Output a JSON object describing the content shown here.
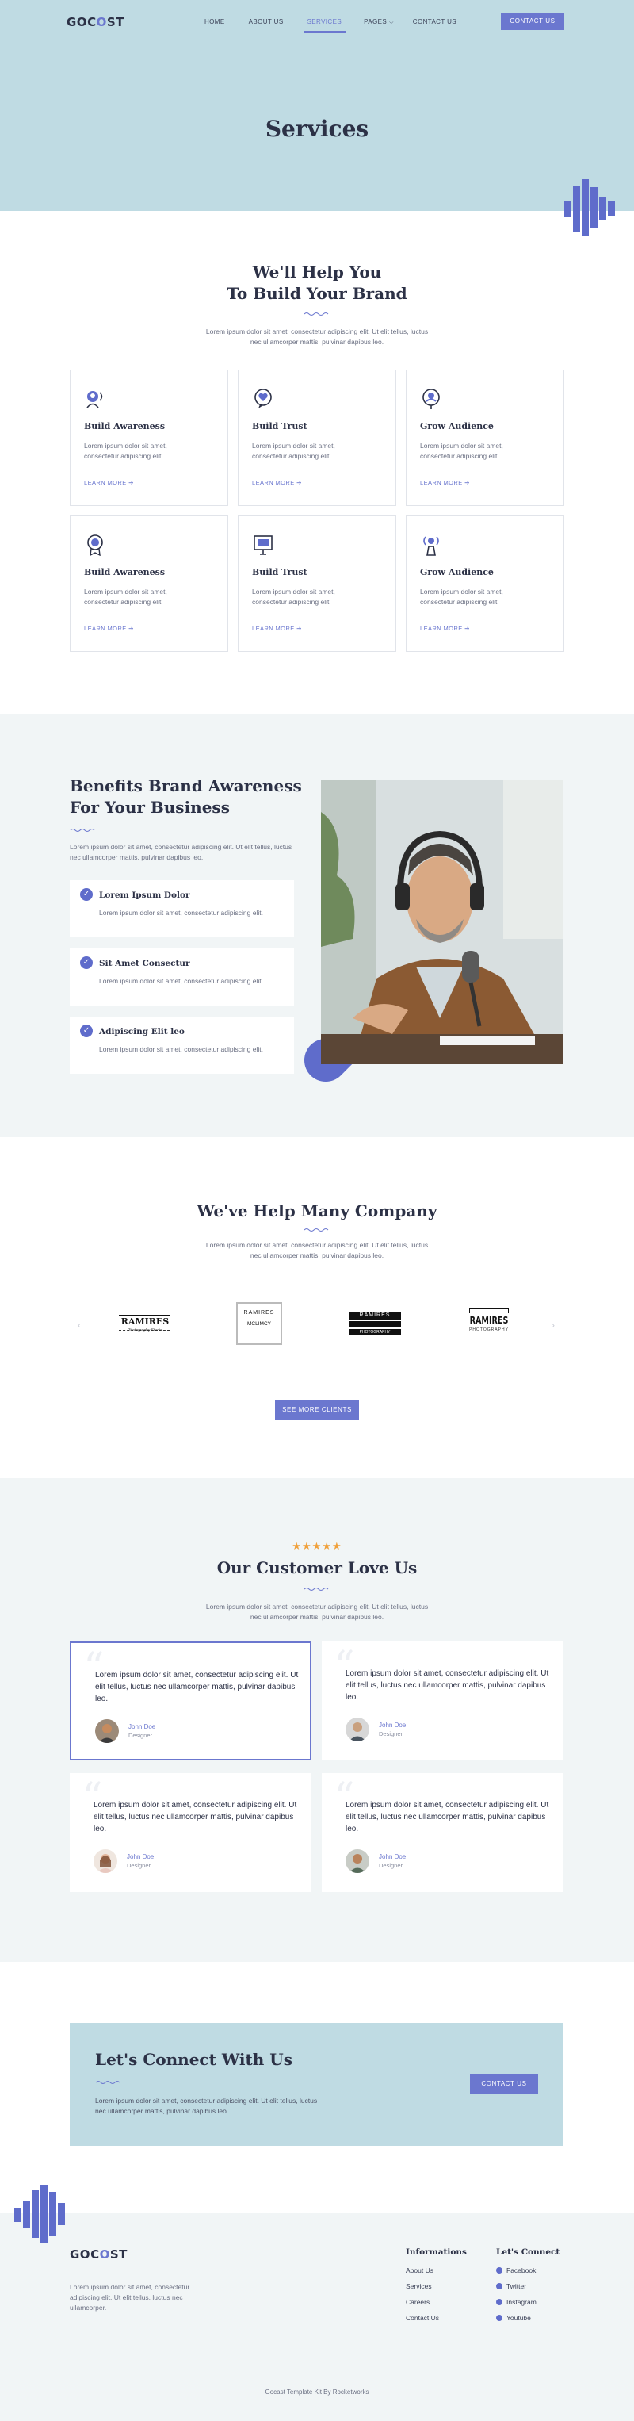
{
  "nav": {
    "logo_left": "GOC",
    "logo_mid": "O",
    "logo_right": "ST",
    "items": [
      "HOME",
      "ABOUT US",
      "SERVICES",
      "PAGES",
      "CONTACT US"
    ],
    "cta": "CONTACT US"
  },
  "hero": {
    "title": "Services"
  },
  "help": {
    "title_line1": "We'll Help You",
    "title_line2": "To Build Your Brand",
    "desc_line1": "Lorem ipsum dolor sit amet, consectetur adipiscing elit. Ut elit tellus, luctus",
    "desc_line2": "nec ullamcorper mattis, pulvinar dapibus leo.",
    "cards": [
      {
        "title": "Build Awareness",
        "text": "Lorem ipsum dolor sit amet, consectetur adipiscing elit.",
        "link": "LEARN MORE",
        "icon": "megaphone-user-icon"
      },
      {
        "title": "Build Trust",
        "text": "Lorem ipsum dolor sit amet, consectetur adipiscing elit.",
        "link": "LEARN MORE",
        "icon": "heart-chat-icon"
      },
      {
        "title": "Grow Audience",
        "text": "Lorem ipsum dolor sit amet, consectetur adipiscing elit.",
        "link": "LEARN MORE",
        "icon": "location-user-icon"
      },
      {
        "title": "Build Awareness",
        "text": "Lorem ipsum dolor sit amet, consectetur adipiscing elit.",
        "link": "LEARN MORE",
        "icon": "award-badge-icon"
      },
      {
        "title": "Build Trust",
        "text": "Lorem ipsum dolor sit amet, consectetur adipiscing elit.",
        "link": "LEARN MORE",
        "icon": "presentation-icon"
      },
      {
        "title": "Grow Audience",
        "text": "Lorem ipsum dolor sit amet, consectetur adipiscing elit.",
        "link": "LEARN MORE",
        "icon": "broadcast-user-icon"
      }
    ]
  },
  "benefits": {
    "title_line1": "Benefits Brand Awareness",
    "title_line2": "For Your Business",
    "desc": "Lorem ipsum dolor sit amet, consectetur adipiscing elit. Ut elit tellus, luctus nec ullamcorper mattis, pulvinar dapibus leo.",
    "items": [
      {
        "title": "Lorem Ipsum Dolor",
        "text": "Lorem ipsum dolor sit amet, consectetur adipiscing elit."
      },
      {
        "title": "Sit Amet Consectur",
        "text": "Lorem ipsum dolor sit amet, consectetur adipiscing elit."
      },
      {
        "title": "Adipiscing Elit leo",
        "text": "Lorem ipsum dolor sit amet, consectetur adipiscing elit."
      }
    ]
  },
  "company": {
    "title": "We've Help Many Company",
    "desc_line1": "Lorem ipsum dolor sit amet, consectetur adipiscing elit. Ut elit tellus, luctus",
    "desc_line2": "nec ullamcorper mattis, pulvinar dapibus leo.",
    "logos": [
      {
        "name": "RAMIRES",
        "sub": "Photography Studio"
      },
      {
        "name": "RAMIRES",
        "sub": "MCLIMCY"
      },
      {
        "name": "RAMIRES",
        "sub": "PHOTOGRAPHY"
      },
      {
        "name": "RAMIRES",
        "sub": "PHOTOGRAPHY"
      }
    ],
    "cta": "SEE MORE CLIENTS"
  },
  "testimonials": {
    "stars": "★★★★★",
    "title": "Our Customer Love Us",
    "desc_line1": "Lorem ipsum dolor sit amet, consectetur adipiscing elit. Ut elit tellus, luctus",
    "desc_line2": "nec ullamcorper mattis, pulvinar dapibus leo.",
    "items": [
      {
        "quote": "Lorem ipsum dolor sit amet, consectetur adipiscing elit. Ut elit tellus, luctus nec ullamcorper mattis, pulvinar dapibus leo.",
        "name": "John Doe",
        "role": "Designer"
      },
      {
        "quote": "Lorem ipsum dolor sit amet, consectetur adipiscing elit. Ut elit tellus, luctus nec ullamcorper mattis, pulvinar dapibus leo.",
        "name": "John Doe",
        "role": "Designer"
      },
      {
        "quote": "Lorem ipsum dolor sit amet, consectetur adipiscing elit. Ut elit tellus, luctus nec ullamcorper mattis, pulvinar dapibus leo.",
        "name": "John Doe",
        "role": "Designer"
      },
      {
        "quote": "Lorem ipsum dolor sit amet, consectetur adipiscing elit. Ut elit tellus, luctus nec ullamcorper mattis, pulvinar dapibus leo.",
        "name": "John Doe",
        "role": "Designer"
      }
    ]
  },
  "connect": {
    "title": "Let's Connect With Us",
    "desc": "Lorem ipsum dolor sit amet, consectetur adipiscing elit. Ut elit tellus, luctus nec ullamcorper mattis, pulvinar dapibus leo.",
    "cta": "CONTACT US"
  },
  "footer": {
    "desc": "Lorem ipsum dolor sit amet, consectetur adipiscing elit. Ut elit tellus, luctus nec ullamcorper.",
    "info_title": "Informations",
    "info_links": [
      "About Us",
      "Services",
      "Careers",
      "Contact Us"
    ],
    "social_title": "Let's Connect",
    "social_links": [
      "Facebook",
      "Twitter",
      "Instagram",
      "Youtube"
    ],
    "copyright": "Gocast Template Kit By Rocketworks"
  },
  "colors": {
    "accent": "#6b77cf",
    "hero_bg": "#bfdbe3",
    "section_bg": "#f1f5f6",
    "star": "#f0a03a",
    "heading": "#2c3146"
  }
}
